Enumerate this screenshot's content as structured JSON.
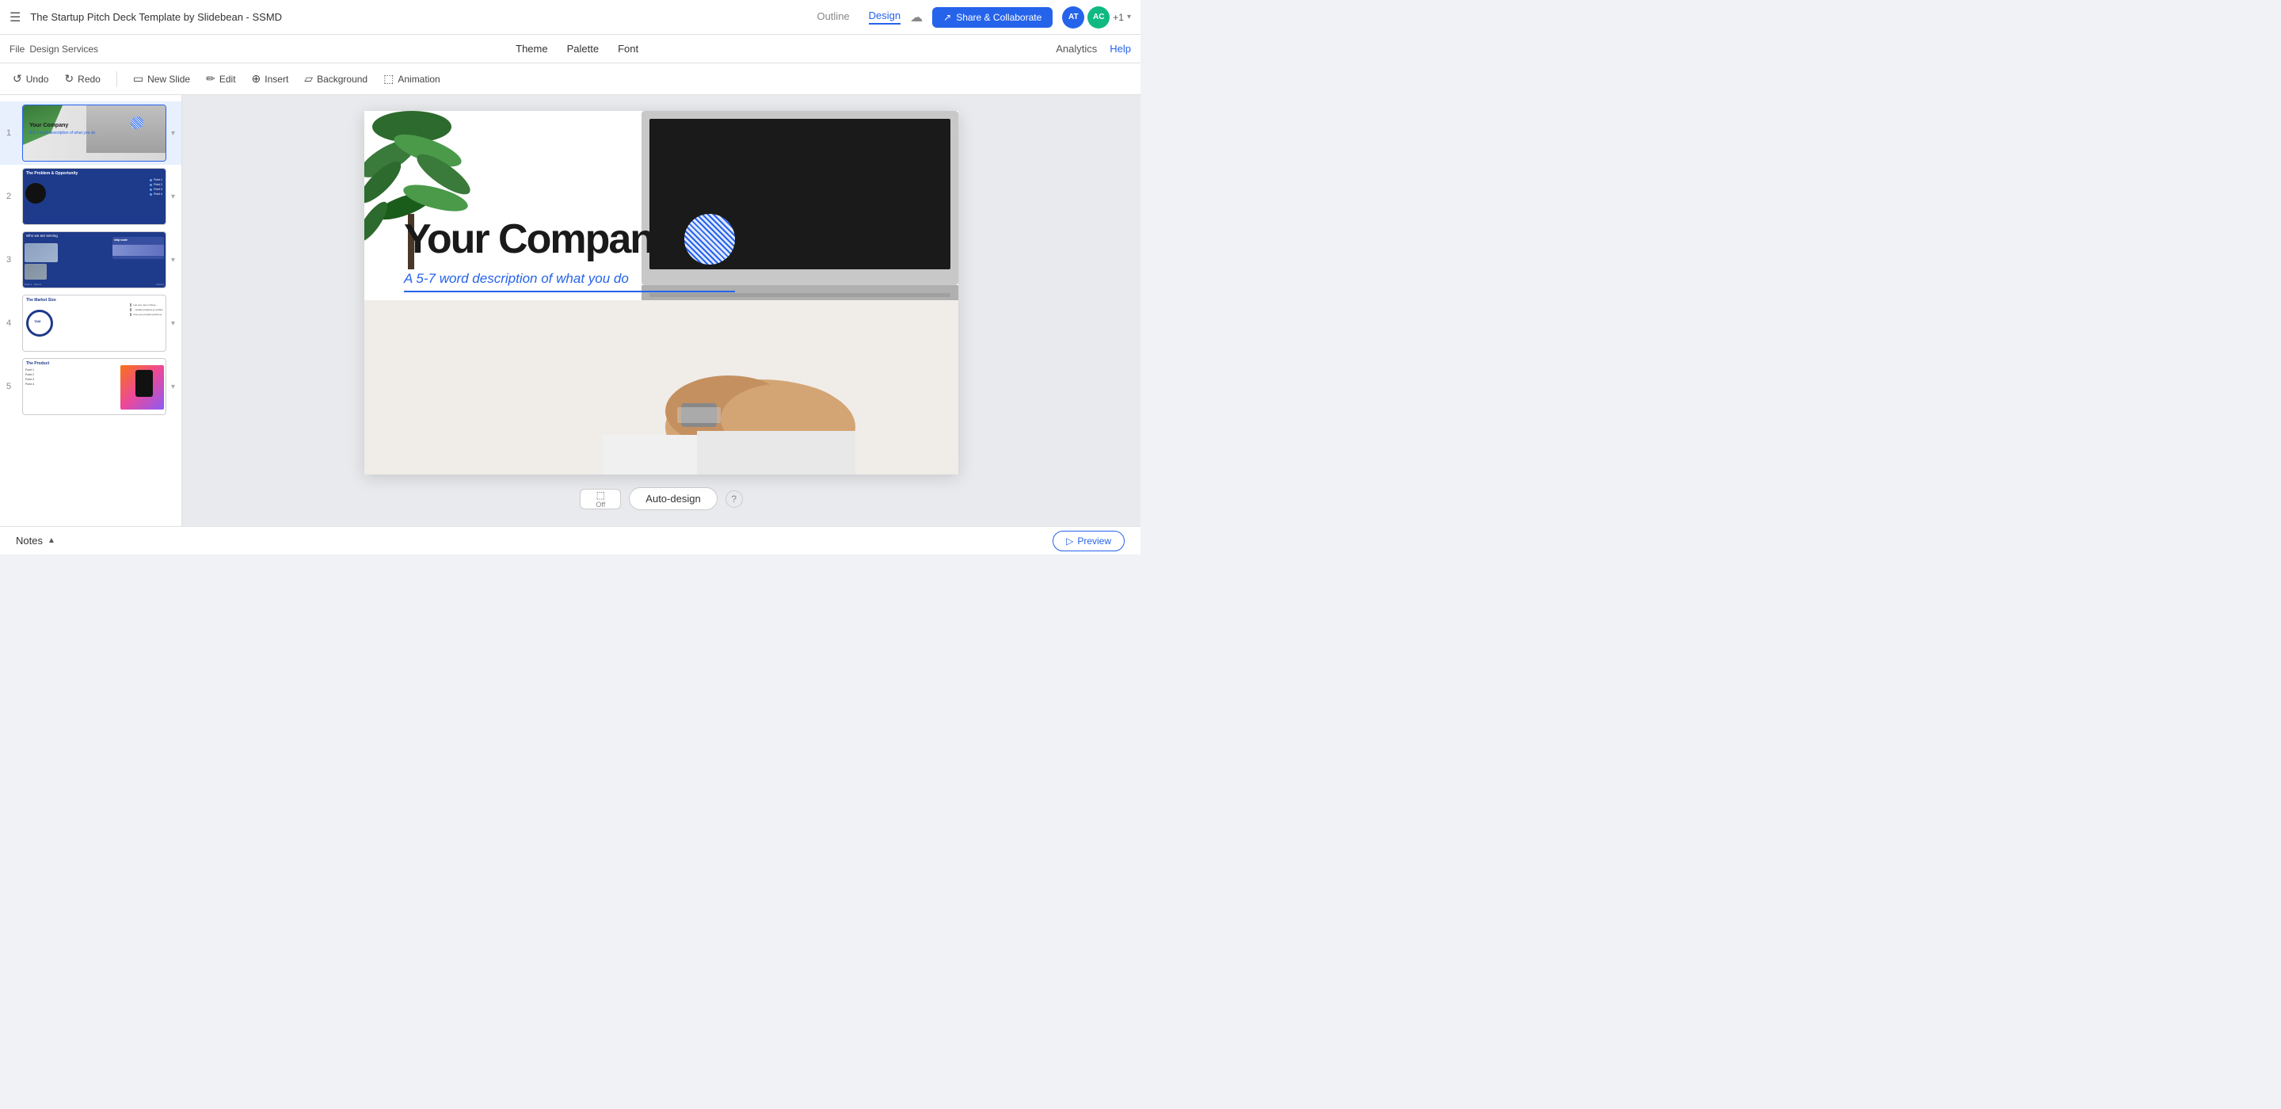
{
  "app": {
    "title": "The Startup Pitch Deck Template by Slidebean - SSMD"
  },
  "header": {
    "menu_icon": "☰",
    "nav_items": [
      {
        "label": "Outline",
        "active": false
      },
      {
        "label": "Design",
        "active": true
      }
    ],
    "cloud_icon": "☁",
    "share_label": "Share & Collaborate",
    "share_icon": "↗",
    "users": "AT AC +1"
  },
  "toolbar2": {
    "theme_label": "Theme",
    "palette_label": "Palette",
    "font_label": "Font",
    "analytics_label": "Analytics",
    "help_label": "Help"
  },
  "edit_toolbar": {
    "undo_label": "Undo",
    "redo_label": "Redo",
    "new_slide_label": "New Slide",
    "edit_label": "Edit",
    "insert_label": "Insert",
    "background_label": "Background",
    "animation_label": "Animation"
  },
  "slides": [
    {
      "number": "1",
      "active": true,
      "title": "Your Company",
      "subtitle": "A 5-7 word description of what you do"
    },
    {
      "number": "2",
      "active": false,
      "title": "The Problem & Opportunity"
    },
    {
      "number": "3",
      "active": false,
      "title": "Who we are serving ship scale"
    },
    {
      "number": "4",
      "active": false,
      "title": "The Market Size",
      "label": "TAM"
    },
    {
      "number": "5",
      "active": false,
      "title": "The Product"
    }
  ],
  "main_slide": {
    "company_name": "Your Company",
    "description": "A 5-7 word description of what you do"
  },
  "auto_design": {
    "toggle_off": "Off",
    "button_label": "Auto-design",
    "help_icon": "?"
  },
  "notes": {
    "label": "Notes",
    "chevron": "▲"
  },
  "preview": {
    "label": "Preview",
    "icon": "▷"
  }
}
